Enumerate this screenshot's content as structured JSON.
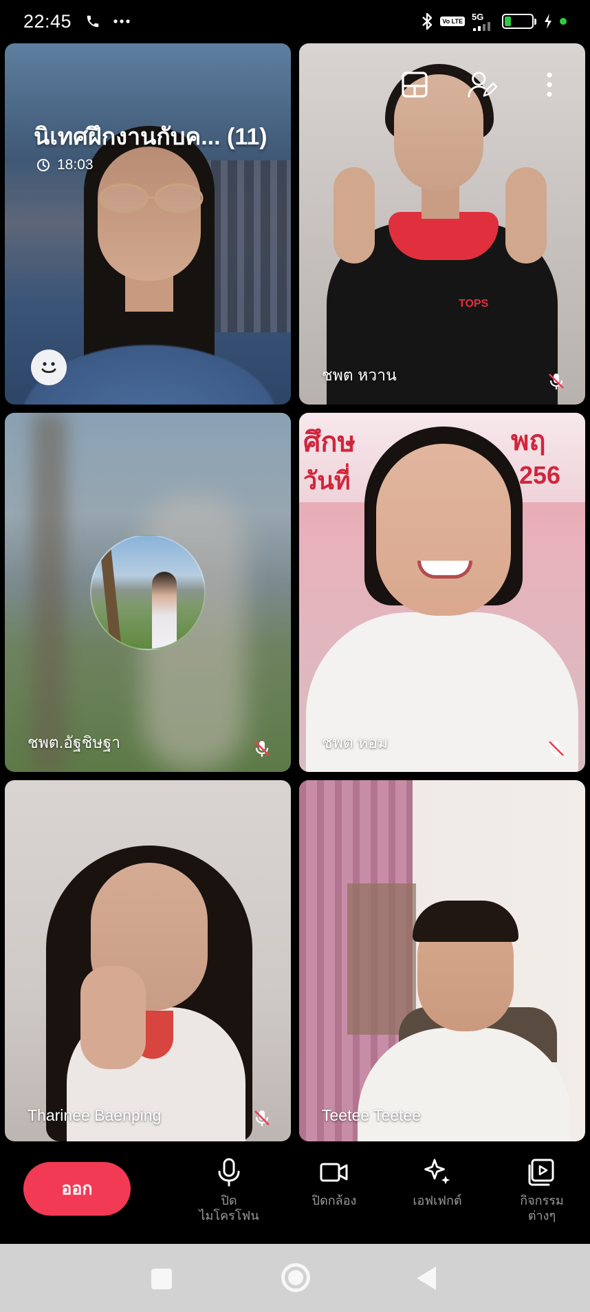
{
  "status_bar": {
    "time": "22:45",
    "network": "5G",
    "lte_badge": "Vo LTE",
    "battery_level": "24",
    "battery_fraction": 0.24,
    "icons": [
      "phone-icon",
      "more-dots-icon",
      "bluetooth-icon",
      "signal-icon",
      "battery-icon",
      "charging-icon"
    ]
  },
  "meeting": {
    "title": "นิเทศฝึกงานกับค... (11)",
    "elapsed": "18:03"
  },
  "participants": [
    {
      "name": "",
      "muted": false
    },
    {
      "name": "ชพต  หวาน",
      "muted": true
    },
    {
      "name": "ชพต.อัฐชิษฐา",
      "muted": true
    },
    {
      "name": "ชพต หอม",
      "muted": true
    },
    {
      "name": "Tharinee Baenping",
      "muted": true
    },
    {
      "name": "Teetee Teetee",
      "muted": false
    }
  ],
  "backdrop_text": {
    "line1_left": "ศึกษ",
    "line1_right": "พฤ",
    "line2_left": "วันที่",
    "line2_right": "256"
  },
  "shirt_logo": "TOPS",
  "controls": {
    "leave": "ออก",
    "mic_line1": "ปิด",
    "mic_line2": "ไมโครโฟน",
    "camera": "ปิดกล้อง",
    "effects": "เอฟเฟกต์",
    "activities_line1": "กิจกรรม",
    "activities_line2": "ต่างๆ"
  },
  "colors": {
    "leave_button": "#f23a54",
    "battery_green": "#2ecc40",
    "control_label": "#9a9a9a"
  }
}
